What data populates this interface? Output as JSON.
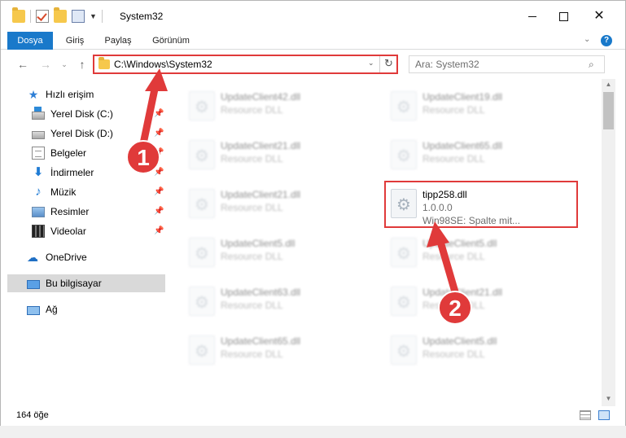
{
  "window": {
    "title": "System32"
  },
  "ribbon": {
    "tabs": [
      {
        "label": "Dosya",
        "active": true
      },
      {
        "label": "Giriş",
        "active": false
      },
      {
        "label": "Paylaş",
        "active": false
      },
      {
        "label": "Görünüm",
        "active": false
      }
    ],
    "help_label": "?"
  },
  "address": {
    "path": "C:\\Windows\\System32",
    "search_placeholder": "Ara: System32"
  },
  "sidebar": {
    "items": [
      {
        "label": "Hızlı erişim",
        "icon": "star-icon",
        "pinned": false
      },
      {
        "label": "Yerel Disk (C:)",
        "icon": "disk-icon",
        "pinned": true
      },
      {
        "label": "Yerel Disk (D:)",
        "icon": "disk-icon",
        "pinned": true
      },
      {
        "label": "Belgeler",
        "icon": "document-icon",
        "pinned": true
      },
      {
        "label": "İndirmeler",
        "icon": "download-icon",
        "pinned": true
      },
      {
        "label": "Müzik",
        "icon": "music-icon",
        "pinned": true
      },
      {
        "label": "Resimler",
        "icon": "pictures-icon",
        "pinned": true
      },
      {
        "label": "Videolar",
        "icon": "videos-icon",
        "pinned": true
      },
      {
        "label": "OneDrive",
        "icon": "cloud-icon",
        "pinned": false
      },
      {
        "label": "Bu bilgisayar",
        "icon": "computer-icon",
        "pinned": false,
        "selected": true
      },
      {
        "label": "Ağ",
        "icon": "network-icon",
        "pinned": false
      }
    ]
  },
  "files": {
    "left": [
      {
        "name": "UpdateClient42.dll",
        "type": "Resource DLL"
      },
      {
        "name": "UpdateClient21.dll",
        "type": "Resource DLL"
      },
      {
        "name": "UpdateClient21.dll",
        "type": "Resource DLL"
      },
      {
        "name": "UpdateClient5.dll",
        "type": "Resource DLL"
      },
      {
        "name": "UpdateClient63.dll",
        "type": "Resource DLL"
      },
      {
        "name": "UpdateClient65.dll",
        "type": "Resource DLL"
      }
    ],
    "right": [
      {
        "name": "UpdateClient19.dll",
        "type": "Resource DLL"
      },
      {
        "name": "UpdateClient65.dll",
        "type": "Resource DLL"
      },
      {
        "name": "UpdateClient5.dll",
        "type": "Resource DLL"
      },
      {
        "name": "UpdateClient21.dll",
        "type": "Resource DLL"
      },
      {
        "name": "UpdateClient5.dll",
        "type": "Resource DLL"
      }
    ],
    "highlighted": {
      "name": "tipp258.dll",
      "version": "1.0.0.0",
      "description": "Win98SE: Spalte mit..."
    }
  },
  "status": {
    "item_count": "164 öğe"
  },
  "annotations": {
    "badge_1": "1",
    "badge_2": "2",
    "color": "#e03a3a"
  }
}
